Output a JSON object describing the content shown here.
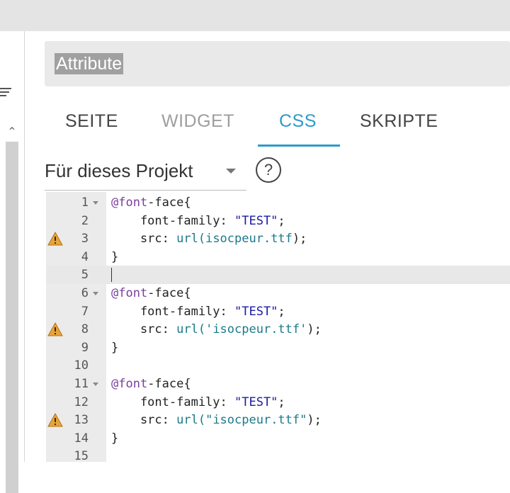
{
  "attributes": {
    "label": "Attribute"
  },
  "tabs": {
    "seite": "SEITE",
    "widget": "WIDGET",
    "css": "CSS",
    "skripte": "SKRIPTE",
    "active": "CSS"
  },
  "scope": {
    "label": "Für dieses Projekt"
  },
  "help": {
    "symbol": "?"
  },
  "editor": {
    "lines": [
      {
        "num": "1",
        "fold": true,
        "warn": false,
        "at": "@font",
        "rest": "-face{"
      },
      {
        "num": "2",
        "fold": false,
        "warn": false,
        "pre": "    font-family: ",
        "str": "\"TEST\"",
        "post": ";"
      },
      {
        "num": "3",
        "fold": false,
        "warn": true,
        "pre": "    src: ",
        "url": "url(",
        "arg": "isocpeur.ttf",
        "post": ");"
      },
      {
        "num": "4",
        "fold": false,
        "warn": false,
        "plain": "}"
      },
      {
        "num": "5",
        "fold": false,
        "warn": false,
        "plain": "",
        "active": true
      },
      {
        "num": "6",
        "fold": true,
        "warn": false,
        "at": "@font",
        "rest": "-face{"
      },
      {
        "num": "7",
        "fold": false,
        "warn": false,
        "pre": "    font-family: ",
        "str": "\"TEST\"",
        "post": ";"
      },
      {
        "num": "8",
        "fold": false,
        "warn": true,
        "pre": "    src: ",
        "url": "url(",
        "arg": "'isocpeur.ttf'",
        "post": ");"
      },
      {
        "num": "9",
        "fold": false,
        "warn": false,
        "plain": "}"
      },
      {
        "num": "10",
        "fold": false,
        "warn": false,
        "plain": ""
      },
      {
        "num": "11",
        "fold": true,
        "warn": false,
        "at": "@font",
        "rest": "-face{"
      },
      {
        "num": "12",
        "fold": false,
        "warn": false,
        "pre": "    font-family: ",
        "str": "\"TEST\"",
        "post": ";"
      },
      {
        "num": "13",
        "fold": false,
        "warn": true,
        "pre": "    src: ",
        "url": "url(",
        "arg": "\"isocpeur.ttf\"",
        "post": ");"
      },
      {
        "num": "14",
        "fold": false,
        "warn": false,
        "plain": "}"
      },
      {
        "num": "15",
        "fold": false,
        "warn": false,
        "plain": ""
      }
    ]
  },
  "colors": {
    "accent": "#2e9acb",
    "warning": "#e8a33a"
  }
}
